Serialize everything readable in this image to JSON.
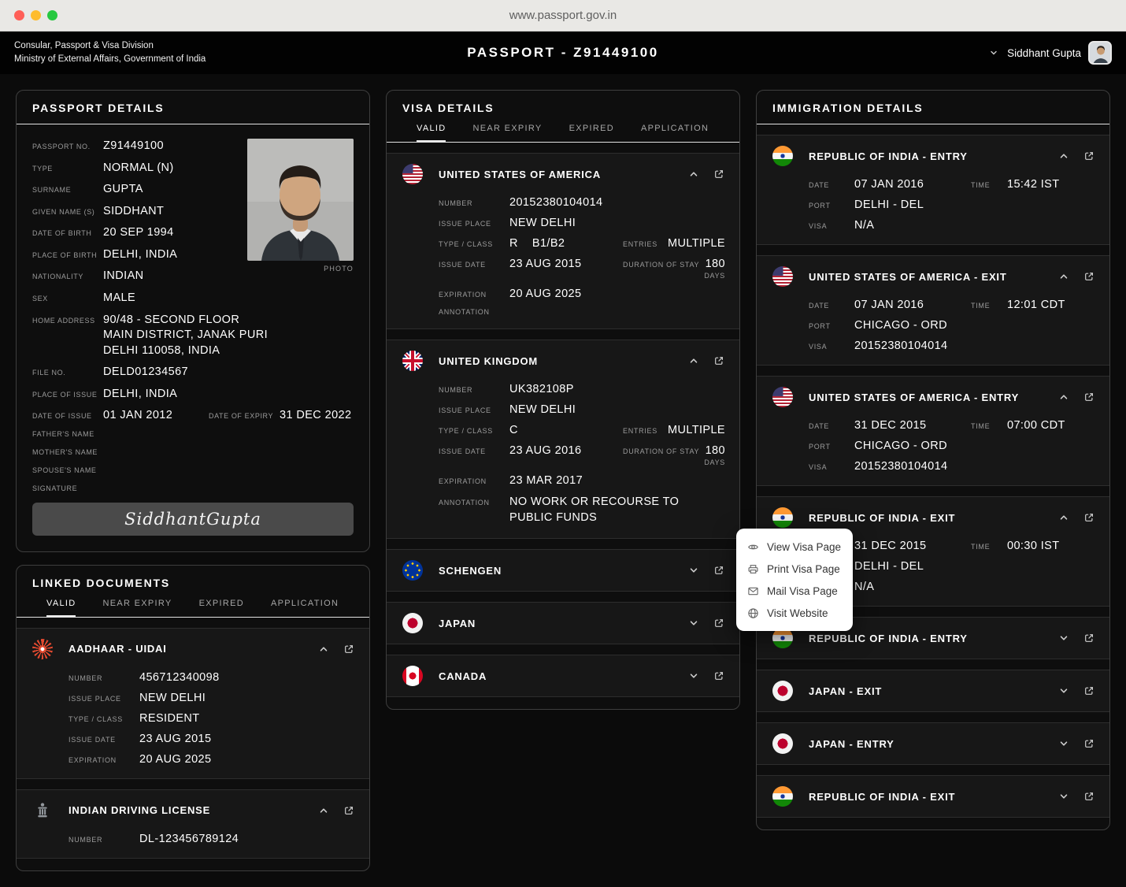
{
  "colors": {
    "accent_red": "#e2492f",
    "card_border": "#3e3e3e",
    "header_bg": "#020202",
    "menu_bg": "#ffffff"
  },
  "browser": {
    "url": "www.passport.gov.in"
  },
  "header": {
    "division": "Consular, Passport & Visa Division",
    "ministry": "Ministry of External Affairs, Government of India",
    "title": "PASSPORT - Z91449100",
    "user_name": "Siddhant Gupta"
  },
  "passport_card": {
    "title": "PASSPORT DETAILS",
    "photo_caption": "PHOTO",
    "fields": [
      {
        "label": "PASSPORT NO.",
        "value": "Z91449100"
      },
      {
        "label": "TYPE",
        "value": "NORMAL (N)"
      },
      {
        "label": "SURNAME",
        "value": "GUPTA"
      },
      {
        "label": "GIVEN NAME (S)",
        "value": "SIDDHANT"
      },
      {
        "label": "DATE OF BIRTH",
        "value": "20 SEP 1994"
      },
      {
        "label": "PLACE OF BIRTH",
        "value": "DELHI, INDIA"
      },
      {
        "label": "NATIONALITY",
        "value": "INDIAN"
      },
      {
        "label": "SEX",
        "value": "MALE"
      }
    ],
    "home_address": {
      "label": "HOME ADDRESS",
      "line1": "90/48 - SECOND FLOOR",
      "line2": "MAIN DISTRICT, JANAK PURI",
      "line3": "DELHI 110058, INDIA"
    },
    "fields2": [
      {
        "label": "FILE NO.",
        "value": "DELD01234567"
      },
      {
        "label": "PLACE OF ISSUE",
        "value": "DELHI, INDIA"
      }
    ],
    "issue": {
      "label": "DATE OF ISSUE",
      "value": "01 JAN 2012"
    },
    "expiry": {
      "label": "DATE OF EXPIRY",
      "value": "31 DEC 2022"
    },
    "empty_fields": [
      {
        "label": "FATHER'S NAME"
      },
      {
        "label": "MOTHER'S NAME"
      },
      {
        "label": "SPOUSE'S NAME"
      }
    ],
    "signature_label": "SIGNATURE",
    "signature_text": "SiddhantGupta"
  },
  "linked_docs": {
    "title": "LINKED DOCUMENTS",
    "tabs": [
      "VALID",
      "NEAR EXPIRY",
      "EXPIRED",
      "APPLICATION"
    ],
    "items": [
      {
        "name": "AADHAAR - UIDAI",
        "fields": [
          {
            "label": "NUMBER",
            "value": "456712340098"
          },
          {
            "label": "ISSUE PLACE",
            "value": "NEW DELHI"
          },
          {
            "label": "TYPE / CLASS",
            "value": "RESIDENT"
          },
          {
            "label": "ISSUE DATE",
            "value": "23 AUG 2015"
          },
          {
            "label": "EXPIRATION",
            "value": "20 AUG 2025"
          }
        ]
      },
      {
        "name": "INDIAN DRIVING LICENSE",
        "fields": [
          {
            "label": "NUMBER",
            "value": "DL-123456789124"
          }
        ]
      }
    ]
  },
  "visa_card": {
    "title": "VISA DETAILS",
    "tabs": [
      "VALID",
      "NEAR EXPIRY",
      "EXPIRED",
      "APPLICATION"
    ],
    "labels": {
      "number": "NUMBER",
      "issue_place": "ISSUE PLACE",
      "type_class": "TYPE / CLASS",
      "entries": "ENTRIES",
      "issue_date": "ISSUE DATE",
      "duration": "DURATION OF STAY",
      "duration_unit": "DAYS",
      "expiration": "EXPIRATION",
      "annotation": "ANNOTATION"
    },
    "items": [
      {
        "name": "UNITED STATES OF AMERICA",
        "number": "20152380104014",
        "issue_place": "NEW DELHI",
        "type": "R",
        "clazz": "B1/B2",
        "entries": "MULTIPLE",
        "issue_date": "23 AUG 2015",
        "duration": "180",
        "expiration": "20 AUG 2025",
        "annotation": ""
      },
      {
        "name": "UNITED KINGDOM",
        "number": "UK382108P",
        "issue_place": "NEW DELHI",
        "type": "C",
        "clazz": "",
        "entries": "MULTIPLE",
        "issue_date": "23 AUG 2016",
        "duration": "180",
        "expiration": "23 MAR 2017",
        "annotation": "NO WORK OR RECOURSE TO PUBLIC FUNDS"
      }
    ],
    "collapsed": [
      "SCHENGEN",
      "JAPAN",
      "CANADA"
    ]
  },
  "immigration_card": {
    "title": "IMMIGRATION DETAILS",
    "labels": {
      "date": "DATE",
      "time": "TIME",
      "port": "PORT",
      "visa": "VISA"
    },
    "items": [
      {
        "name": "REPUBLIC OF INDIA - ENTRY",
        "date": "07 JAN 2016",
        "time": "15:42 IST",
        "port": "DELHI - DEL",
        "visa": "N/A"
      },
      {
        "name": "UNITED STATES OF AMERICA - EXIT",
        "date": "07 JAN 2016",
        "time": "12:01 CDT",
        "port": "CHICAGO - ORD",
        "visa": "20152380104014"
      },
      {
        "name": "UNITED STATES OF AMERICA - ENTRY",
        "date": "31 DEC 2015",
        "time": "07:00 CDT",
        "port": "CHICAGO - ORD",
        "visa": "20152380104014"
      },
      {
        "name": "REPUBLIC OF INDIA - EXIT",
        "date": "31 DEC 2015",
        "time": "00:30 IST",
        "port": "DELHI - DEL",
        "visa": "N/A"
      },
      {
        "name": "REPUBLIC OF INDIA - ENTRY"
      },
      {
        "name": "JAPAN - EXIT"
      },
      {
        "name": "JAPAN - ENTRY"
      },
      {
        "name": "REPUBLIC OF INDIA - EXIT"
      }
    ]
  },
  "context_menu": {
    "items": [
      {
        "label": "View Visa Page"
      },
      {
        "label": "Print Visa Page"
      },
      {
        "label": "Mail Visa Page"
      },
      {
        "label": "Visit Website"
      }
    ]
  }
}
